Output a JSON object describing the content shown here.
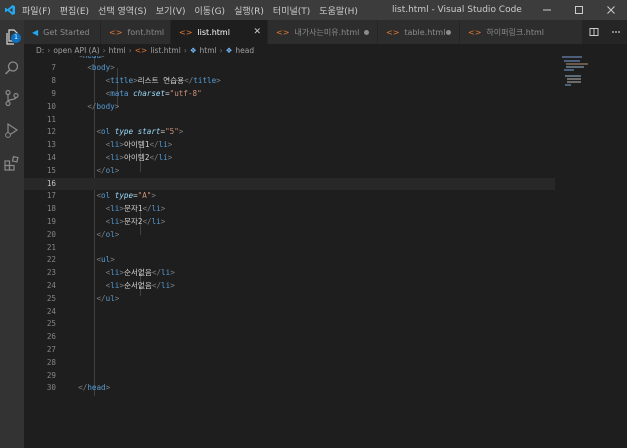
{
  "window": {
    "title": "list.html - Visual Studio Code"
  },
  "menu": [
    "파일(F)",
    "편집(E)",
    "선택 영역(S)",
    "보기(V)",
    "이동(G)",
    "실행(R)",
    "터미널(T)",
    "도움말(H)"
  ],
  "activity": {
    "badge": "1"
  },
  "tabs": [
    {
      "label": "Get Started",
      "icon": "vscode-logo-icon",
      "active": false
    },
    {
      "label": "font.html",
      "icon": "html-icon",
      "active": false
    },
    {
      "label": "list.html",
      "icon": "html-icon",
      "active": true
    },
    {
      "label": "내가사는미유.html",
      "icon": "html-icon",
      "active": false,
      "modified": true
    },
    {
      "label": "table.html",
      "icon": "html-icon",
      "active": false,
      "modified": true
    },
    {
      "label": "하이퍼링크.html",
      "icon": "html-icon",
      "active": false
    }
  ],
  "breadcrumb": [
    "D:",
    "open API (A)",
    "html",
    "list.html",
    "html",
    "head"
  ],
  "colors": {
    "tag": "#569cd6",
    "attr": "#9cdcfe",
    "string": "#ce9178",
    "text": "#d4d4d4",
    "punct": "#808080"
  },
  "editor": {
    "current_line": 13,
    "lines": [
      {
        "n": "",
        "tokens": [
          [
            "p",
            "<"
          ],
          [
            "t",
            "head"
          ],
          [
            "p",
            ">"
          ]
        ],
        "indent": 2,
        "partial": true
      },
      {
        "n": "7",
        "tokens": [
          [
            "p",
            "<"
          ],
          [
            "t",
            "body"
          ],
          [
            "p",
            ">"
          ]
        ],
        "indent": 4
      },
      {
        "n": "8",
        "tokens": [
          [
            "p",
            "<"
          ],
          [
            "t",
            "title"
          ],
          [
            "p",
            ">"
          ],
          [
            "x",
            "리스트 연습용"
          ],
          [
            "p",
            "</"
          ],
          [
            "t",
            "title"
          ],
          [
            "p",
            ">"
          ]
        ],
        "indent": 8
      },
      {
        "n": "9",
        "tokens": [
          [
            "p",
            "<"
          ],
          [
            "t",
            "mata "
          ],
          [
            "a",
            "charset"
          ],
          [
            "x",
            "="
          ],
          [
            "s",
            "\"utf-8\""
          ]
        ],
        "indent": 8
      },
      {
        "n": "10",
        "tokens": [
          [
            "p",
            "</"
          ],
          [
            "t",
            "body"
          ],
          [
            "p",
            ">"
          ]
        ],
        "indent": 4
      },
      {
        "n": "11",
        "tokens": [],
        "indent": 0
      },
      {
        "n": "12",
        "tokens": [
          [
            "p",
            "<"
          ],
          [
            "t",
            "ol "
          ],
          [
            "a",
            "type"
          ],
          [
            "x",
            " "
          ],
          [
            "a",
            "start"
          ],
          [
            "x",
            "="
          ],
          [
            "s",
            "\"5\""
          ],
          [
            "p",
            ">"
          ]
        ],
        "indent": 6
      },
      {
        "n": "13",
        "tokens": [
          [
            "p",
            "<"
          ],
          [
            "t",
            "li"
          ],
          [
            "p",
            ">"
          ],
          [
            "x",
            "아이템1"
          ],
          [
            "p",
            "</"
          ],
          [
            "t",
            "li"
          ],
          [
            "p",
            ">"
          ]
        ],
        "indent": 8
      },
      {
        "n": "14",
        "tokens": [
          [
            "p",
            "<"
          ],
          [
            "t",
            "li"
          ],
          [
            "p",
            ">"
          ],
          [
            "x",
            "아이템2"
          ],
          [
            "p",
            "</"
          ],
          [
            "t",
            "li"
          ],
          [
            "p",
            ">"
          ]
        ],
        "indent": 8
      },
      {
        "n": "15",
        "tokens": [
          [
            "p",
            "</"
          ],
          [
            "t",
            "ol"
          ],
          [
            "p",
            ">"
          ]
        ],
        "indent": 6
      },
      {
        "n": "16",
        "tokens": [],
        "indent": 0,
        "current": true
      },
      {
        "n": "17",
        "tokens": [
          [
            "p",
            "<"
          ],
          [
            "t",
            "ol "
          ],
          [
            "a",
            "type"
          ],
          [
            "x",
            "="
          ],
          [
            "s",
            "\"A\""
          ],
          [
            "p",
            ">"
          ]
        ],
        "indent": 6
      },
      {
        "n": "18",
        "tokens": [
          [
            "p",
            "<"
          ],
          [
            "t",
            "li"
          ],
          [
            "p",
            ">"
          ],
          [
            "x",
            "문자1"
          ],
          [
            "p",
            "</"
          ],
          [
            "t",
            "li"
          ],
          [
            "p",
            ">"
          ]
        ],
        "indent": 8
      },
      {
        "n": "19",
        "tokens": [
          [
            "p",
            "<"
          ],
          [
            "t",
            "li"
          ],
          [
            "p",
            ">"
          ],
          [
            "x",
            "문자2"
          ],
          [
            "p",
            "</"
          ],
          [
            "t",
            "li"
          ],
          [
            "p",
            ">"
          ]
        ],
        "indent": 8
      },
      {
        "n": "20",
        "tokens": [
          [
            "p",
            "</"
          ],
          [
            "t",
            "ol"
          ],
          [
            "p",
            ">"
          ]
        ],
        "indent": 6
      },
      {
        "n": "21",
        "tokens": [],
        "indent": 0
      },
      {
        "n": "22",
        "tokens": [
          [
            "p",
            "<"
          ],
          [
            "t",
            "ul"
          ],
          [
            "p",
            ">"
          ]
        ],
        "indent": 6
      },
      {
        "n": "23",
        "tokens": [
          [
            "p",
            "<"
          ],
          [
            "t",
            "li"
          ],
          [
            "p",
            ">"
          ],
          [
            "x",
            "순서없음"
          ],
          [
            "p",
            "</"
          ],
          [
            "t",
            "li"
          ],
          [
            "p",
            ">"
          ]
        ],
        "indent": 8
      },
      {
        "n": "24",
        "tokens": [
          [
            "p",
            "<"
          ],
          [
            "t",
            "li"
          ],
          [
            "p",
            ">"
          ],
          [
            "x",
            "순서없음"
          ],
          [
            "p",
            "</"
          ],
          [
            "t",
            "li"
          ],
          [
            "p",
            ">"
          ]
        ],
        "indent": 8
      },
      {
        "n": "25",
        "tokens": [
          [
            "p",
            "</"
          ],
          [
            "t",
            "ul"
          ],
          [
            "p",
            ">"
          ]
        ],
        "indent": 6
      },
      {
        "n": "24",
        "tokens": [],
        "indent": 0
      },
      {
        "n": "25",
        "tokens": [],
        "indent": 0
      },
      {
        "n": "26",
        "tokens": [],
        "indent": 0
      },
      {
        "n": "27",
        "tokens": [],
        "indent": 0
      },
      {
        "n": "28",
        "tokens": [],
        "indent": 0
      },
      {
        "n": "29",
        "tokens": [],
        "indent": 0
      },
      {
        "n": "30",
        "tokens": [
          [
            "p",
            "</"
          ],
          [
            "t",
            "head"
          ],
          [
            "p",
            ">"
          ]
        ],
        "indent": 2
      }
    ]
  }
}
